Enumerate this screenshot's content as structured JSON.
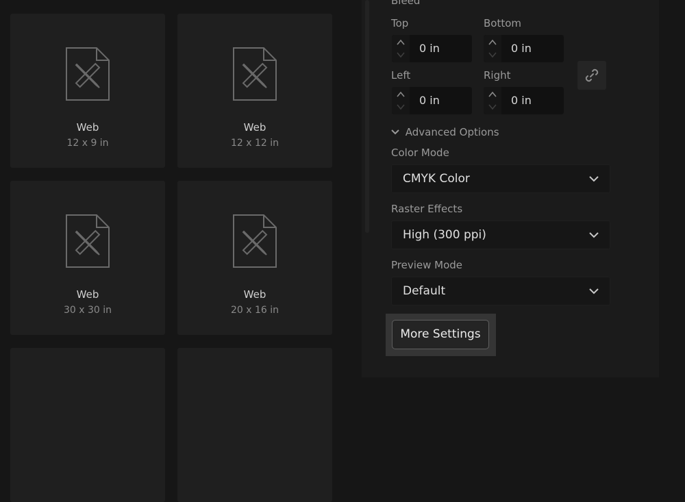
{
  "presets": [
    {
      "name": "Web",
      "size": "12 x 9 in"
    },
    {
      "name": "Web",
      "size": "12 x 12 in"
    },
    {
      "name": "Web",
      "size": "30 x 30 in"
    },
    {
      "name": "Web",
      "size": "20 x 16 in"
    }
  ],
  "bleed": {
    "section_label": "Bleed",
    "top_label": "Top",
    "top_value": "0 in",
    "bottom_label": "Bottom",
    "bottom_value": "0 in",
    "left_label": "Left",
    "left_value": "0 in",
    "right_label": "Right",
    "right_value": "0 in",
    "link_icon": "link-icon"
  },
  "advanced": {
    "toggle_label": "Advanced Options",
    "color_mode_label": "Color Mode",
    "color_mode_value": "CMYK Color",
    "raster_label": "Raster Effects",
    "raster_value": "High (300 ppi)",
    "preview_label": "Preview Mode",
    "preview_value": "Default"
  },
  "more_settings_label": "More Settings"
}
